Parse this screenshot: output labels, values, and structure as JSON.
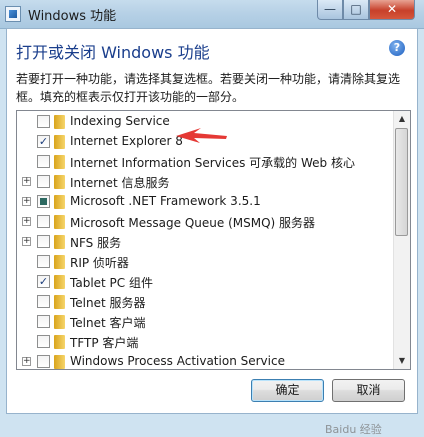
{
  "window": {
    "title": "Windows 功能",
    "minimize_glyph": "—",
    "maximize_glyph": "□",
    "close_glyph": "✕"
  },
  "heading": "打开或关闭 Windows 功能",
  "help_glyph": "?",
  "description": "若要打开一种功能，请选择其复选框。若要关闭一种功能，请清除其复选框。填充的框表示仅打开该功能的一部分。",
  "features": [
    {
      "label": "Indexing Service",
      "expandable": false,
      "state": "unchecked"
    },
    {
      "label": "Internet Explorer 8",
      "expandable": false,
      "state": "checked"
    },
    {
      "label": "Internet Information Services 可承载的 Web 核心",
      "expandable": false,
      "state": "unchecked"
    },
    {
      "label": "Internet 信息服务",
      "expandable": true,
      "state": "unchecked"
    },
    {
      "label": "Microsoft .NET Framework 3.5.1",
      "expandable": true,
      "state": "partial"
    },
    {
      "label": "Microsoft Message Queue (MSMQ) 服务器",
      "expandable": true,
      "state": "unchecked"
    },
    {
      "label": "NFS 服务",
      "expandable": true,
      "state": "unchecked"
    },
    {
      "label": "RIP 侦听器",
      "expandable": false,
      "state": "unchecked"
    },
    {
      "label": "Tablet PC 组件",
      "expandable": false,
      "state": "checked"
    },
    {
      "label": "Telnet 服务器",
      "expandable": false,
      "state": "unchecked"
    },
    {
      "label": "Telnet 客户端",
      "expandable": false,
      "state": "unchecked"
    },
    {
      "label": "TFTP 客户端",
      "expandable": false,
      "state": "unchecked"
    },
    {
      "label": "Windows Process Activation Service",
      "expandable": true,
      "state": "unchecked"
    }
  ],
  "glyphs": {
    "check": "✓",
    "plus": "+",
    "up": "▲",
    "down": "▼"
  },
  "buttons": {
    "ok": "确定",
    "cancel": "取消"
  },
  "watermark": "Baidu 经验",
  "colors": {
    "heading": "#1a3e8c",
    "arrow": "#e53935"
  }
}
